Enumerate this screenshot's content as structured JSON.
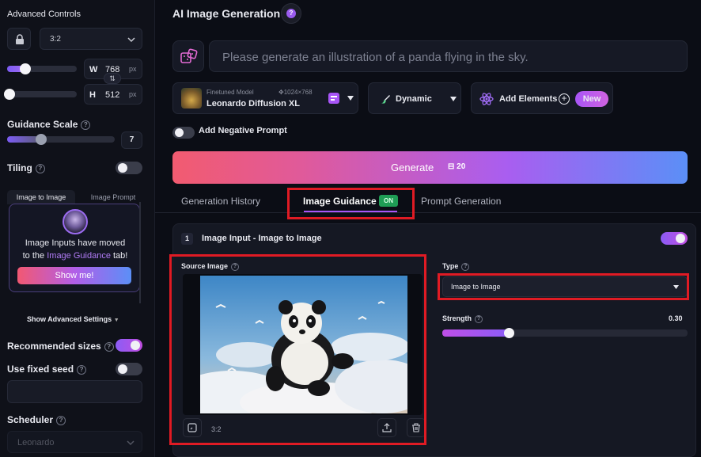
{
  "sidebar": {
    "section_title": "Advanced Controls",
    "aspect_ratio": "3:2",
    "width_label": "W",
    "width_value": "768",
    "height_label": "H",
    "height_value": "512",
    "unit": "px",
    "width_slider_fraction": 0.3,
    "height_slider_fraction": 0.0,
    "guidance_label": "Guidance Scale",
    "guidance_value": "7",
    "guidance_fraction": 0.3,
    "tiling_label": "Tiling",
    "tabs": [
      "Image to Image",
      "Image Prompt"
    ],
    "notice_text_1": "Image Inputs have moved",
    "notice_text_2": "to the",
    "notice_link": "Image Guidance",
    "notice_text_3": "tab!",
    "show_me": "Show me!",
    "show_advanced": "Show Advanced Settings",
    "recommended_label": "Recommended sizes",
    "fixed_seed_label": "Use fixed seed",
    "scheduler_label": "Scheduler",
    "scheduler_value": "Leonardo"
  },
  "header": {
    "title": "AI Image Generation"
  },
  "prompt": {
    "placeholder": "Please generate an illustration of a panda flying in the sky."
  },
  "model": {
    "caption": "Finetuned Model",
    "size": "1024×768",
    "name": "Leonardo Diffusion XL"
  },
  "style": {
    "name": "Dynamic"
  },
  "elements": {
    "label": "Add Elements",
    "badge": "New"
  },
  "negative": {
    "label": "Add Negative Prompt"
  },
  "generate": {
    "label": "Generate",
    "cost": "20"
  },
  "tabs": {
    "history": "Generation History",
    "guidance": "Image Guidance",
    "guidance_badge": "ON",
    "prompt_gen": "Prompt Generation"
  },
  "panel": {
    "index": "1",
    "title": "Image Input - Image to Image",
    "source_label": "Source Image",
    "source_ratio": "3:2",
    "type_label": "Type",
    "type_value": "Image to Image",
    "strength_label": "Strength",
    "strength_value": "0.30",
    "strength_fraction": 0.25
  },
  "colors": {
    "accent": "#a855f7",
    "highlight": "#e01b24",
    "on_badge": "#1f9d55"
  }
}
